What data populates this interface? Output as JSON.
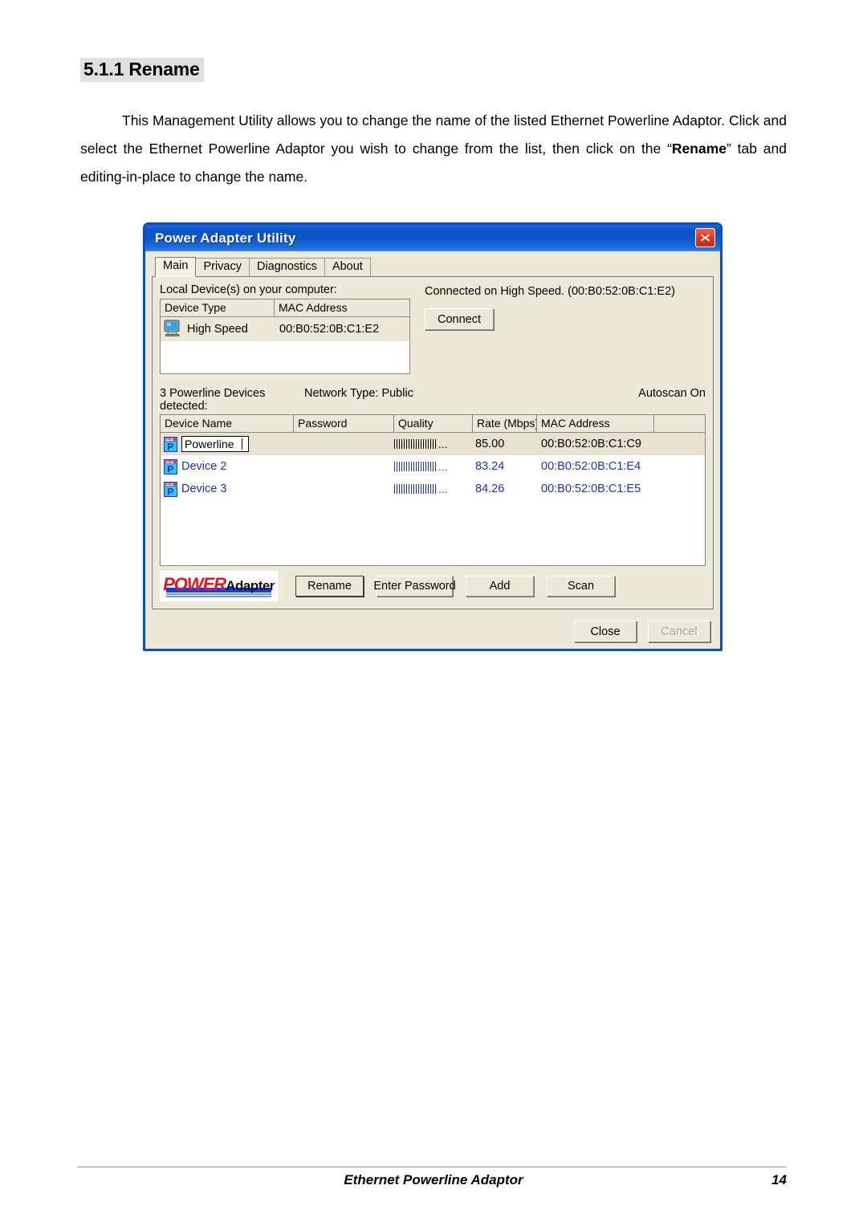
{
  "document": {
    "heading": "5.1.1 Rename",
    "paragraph_part1": "This Management Utility allows you to change the name of the listed Ethernet Powerline Adaptor. Click and select the Ethernet Powerline Adaptor you wish to change from the list, then click on the “",
    "paragraph_bold": "Rename",
    "paragraph_part2": "” tab and editing-in-place to change the name.",
    "footer_title": "Ethernet Powerline Adaptor",
    "footer_page": "14"
  },
  "dialog": {
    "title": "Power Adapter Utility",
    "close_icon": "close-icon",
    "tabs": [
      {
        "label": "Main",
        "active": true
      },
      {
        "label": "Privacy",
        "active": false
      },
      {
        "label": "Diagnostics",
        "active": false
      },
      {
        "label": "About",
        "active": false
      }
    ],
    "local_section": {
      "label": "Local Device(s) on your computer:",
      "columns": [
        "Device Type",
        "MAC Address"
      ],
      "rows": [
        {
          "icon": "computer-icon",
          "device_type": "High Speed",
          "mac_address": "00:B0:52:0B:C1:E2"
        }
      ],
      "status_text": "Connected on  High Speed. (00:B0:52:0B:C1:E2)",
      "connect_label": "Connect"
    },
    "powerline_section": {
      "detected_text": "3 Powerline Devices detected:",
      "network_type_text": "Network Type: Public",
      "autoscan_text": "Autoscan On",
      "columns": [
        "Device Name",
        "Password",
        "Quality",
        "Rate (Mbps)",
        "MAC Address",
        ""
      ],
      "rows": [
        {
          "icon": "powerline-device-icon",
          "device_name": "Powerline",
          "editing": true,
          "password": "",
          "quality_bars": 18,
          "quality_suffix": "...",
          "rate": "85.00",
          "mac_address": "00:B0:52:0B:C1:C9",
          "selected": true
        },
        {
          "icon": "powerline-device-icon",
          "device_name": "Device 2",
          "editing": false,
          "password": "",
          "quality_bars": 18,
          "quality_suffix": "...",
          "rate": "83.24",
          "mac_address": "00:B0:52:0B:C1:E4",
          "selected": false
        },
        {
          "icon": "powerline-device-icon",
          "device_name": "Device 3",
          "editing": false,
          "password": "",
          "quality_bars": 18,
          "quality_suffix": "...",
          "rate": "84.26",
          "mac_address": "00:B0:52:0B:C1:E5",
          "selected": false
        }
      ]
    },
    "logo": {
      "part1": "POWER",
      "part2": "Adapter"
    },
    "action_buttons": [
      {
        "label": "Rename",
        "default": true,
        "disabled": false
      },
      {
        "label": "Enter Password",
        "default": false,
        "disabled": false
      },
      {
        "label": "Add",
        "default": false,
        "disabled": false
      },
      {
        "label": "Scan",
        "default": false,
        "disabled": false
      }
    ],
    "footer_buttons": [
      {
        "label": "Close",
        "disabled": false
      },
      {
        "label": "Cancel",
        "disabled": true
      }
    ],
    "colors": {
      "titlebar": "#0a53c8",
      "face": "#ece9d8",
      "link_blue": "#1a2fd0",
      "selection": "#e6e2cf",
      "logo_red": "#e8151c",
      "logo_blue": "#1b3fd4"
    }
  }
}
